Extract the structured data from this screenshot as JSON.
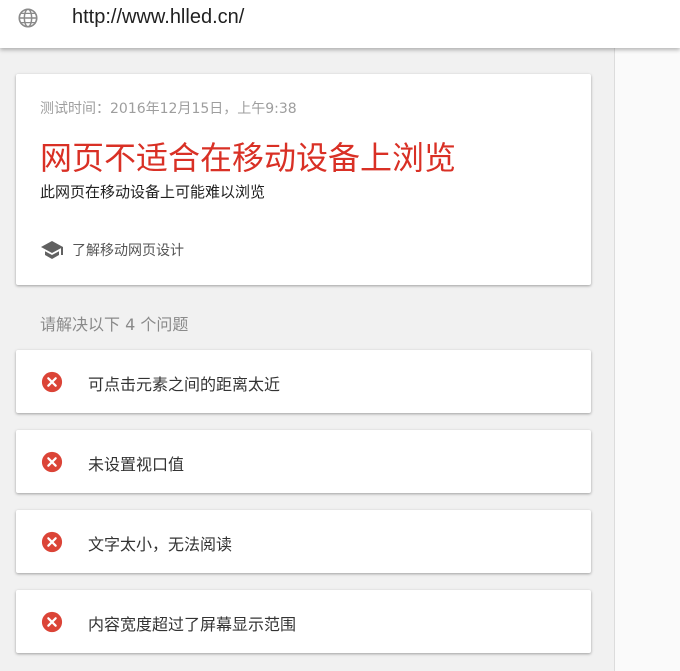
{
  "address_bar": {
    "url": "http://www.hlled.cn/",
    "icon": "globe-icon"
  },
  "summary": {
    "test_time": "测试时间：2016年12月15日，上午9:38",
    "verdict": "网页不适合在移动设备上浏览",
    "subtitle": "此网页在移动设备上可能难以浏览",
    "learn_link": "了解移动网页设计",
    "learn_icon": "graduation-cap-icon"
  },
  "issues_header": "请解决以下 4 个问题",
  "issues": [
    {
      "label": "可点击元素之间的距离太近",
      "icon": "error-icon"
    },
    {
      "label": "未设置视口值",
      "icon": "error-icon"
    },
    {
      "label": "文字太小，无法阅读",
      "icon": "error-icon"
    },
    {
      "label": "内容宽度超过了屏幕显示范围",
      "icon": "error-icon"
    }
  ],
  "colors": {
    "verdict": "#d93025",
    "error_icon": "#db4437",
    "background": "#f1f1f1"
  }
}
